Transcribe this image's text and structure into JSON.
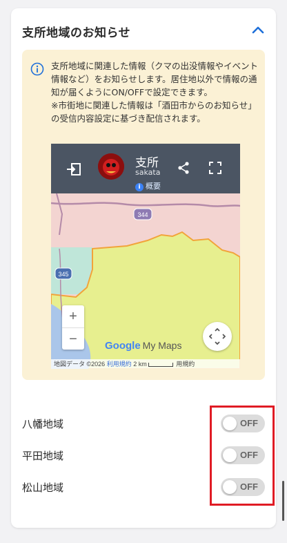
{
  "section": {
    "title": "支所地域のお知らせ",
    "expanded": true
  },
  "notice": {
    "line1": "支所地域に関連した情報（クマの出没情報やイベント情報など）をお知らせします。居住地以外で情報の通知が届くようにON/OFFで設定できます。",
    "line2": "※市街地に関連した情報は「酒田市からのお知らせ」の受信内容設定に基づき配信されます。"
  },
  "map": {
    "title": "支所",
    "subtitle": "sakata",
    "info_link": "概要",
    "road_labels": [
      "344",
      "345"
    ],
    "logo_google": "Google",
    "logo_suffix": "My Maps",
    "attribution_data": "地図データ ©2026",
    "attribution_terms": "利用規約",
    "scale": "2 km",
    "attribution_terms2": "用規約",
    "colors": {
      "bar": "#4b5563",
      "region_pink": "#f3d4d1",
      "region_yellow": "#e7ef8f",
      "border": "#f2a33a"
    }
  },
  "toggles": [
    {
      "label": "八幡地域",
      "state": "OFF"
    },
    {
      "label": "平田地域",
      "state": "OFF"
    },
    {
      "label": "松山地域",
      "state": "OFF"
    }
  ],
  "colors": {
    "accent": "#1e6fd9",
    "highlight": "#e01b24",
    "notice_bg": "#fbf1d5"
  },
  "icons": [
    "chevron-up-icon",
    "info-icon",
    "exit-icon",
    "share-icon",
    "fullscreen-icon",
    "recenter-icon"
  ]
}
